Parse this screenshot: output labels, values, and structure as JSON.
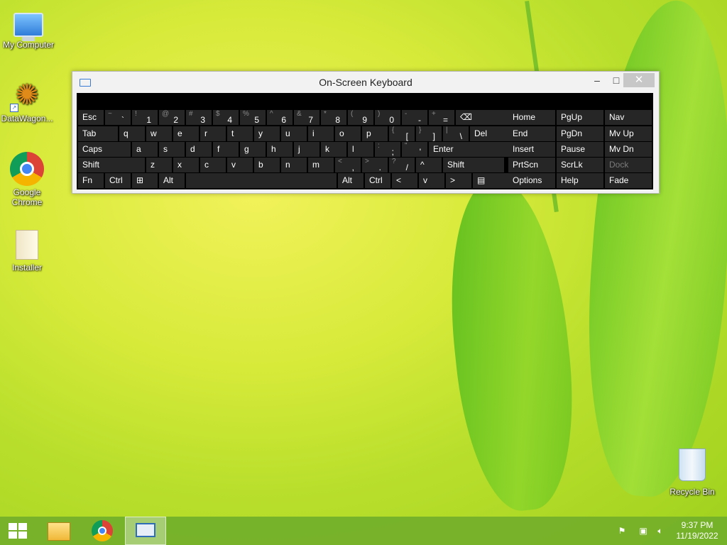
{
  "desktop": {
    "icons": [
      {
        "label": "My Computer",
        "icon": "computer-icon"
      },
      {
        "label": "DataWagon...",
        "icon": "datawagon-icon"
      },
      {
        "label": "Google Chrome",
        "icon": "chrome-icon"
      },
      {
        "label": "Installer",
        "icon": "folder-icon"
      },
      {
        "label": "Recycle Bin",
        "icon": "recycle-bin-icon"
      }
    ]
  },
  "osk": {
    "title": "On-Screen Keyboard",
    "controls": {
      "minimize": "–",
      "maximize": "□",
      "close": "✕"
    },
    "rows": [
      [
        {
          "id": "esc",
          "label": "Esc"
        },
        {
          "id": "tilde",
          "up": "~",
          "low": "`"
        },
        {
          "id": "1",
          "up": "!",
          "low": "1"
        },
        {
          "id": "2",
          "up": "@",
          "low": "2"
        },
        {
          "id": "3",
          "up": "#",
          "low": "3"
        },
        {
          "id": "4",
          "up": "$",
          "low": "4"
        },
        {
          "id": "5",
          "up": "%",
          "low": "5"
        },
        {
          "id": "6",
          "up": "^",
          "low": "6"
        },
        {
          "id": "7",
          "up": "&",
          "low": "7"
        },
        {
          "id": "8",
          "up": "*",
          "low": "8"
        },
        {
          "id": "9",
          "up": "(",
          "low": "9"
        },
        {
          "id": "0",
          "up": ")",
          "low": "0"
        },
        {
          "id": "minus",
          "up": "-",
          "low": "-"
        },
        {
          "id": "equals",
          "up": "+",
          "low": "="
        },
        {
          "id": "backspace",
          "label": "⌫"
        }
      ],
      [
        {
          "id": "tab",
          "label": "Tab"
        },
        {
          "id": "q",
          "label": "q"
        },
        {
          "id": "w",
          "label": "w"
        },
        {
          "id": "e",
          "label": "e"
        },
        {
          "id": "r",
          "label": "r"
        },
        {
          "id": "t",
          "label": "t"
        },
        {
          "id": "y",
          "label": "y"
        },
        {
          "id": "u",
          "label": "u"
        },
        {
          "id": "i",
          "label": "i"
        },
        {
          "id": "o",
          "label": "o"
        },
        {
          "id": "p",
          "label": "p"
        },
        {
          "id": "lbracket",
          "up": "{",
          "low": "["
        },
        {
          "id": "rbracket",
          "up": "}",
          "low": "]"
        },
        {
          "id": "backslash",
          "up": "|",
          "low": "\\"
        },
        {
          "id": "del",
          "label": "Del"
        }
      ],
      [
        {
          "id": "caps",
          "label": "Caps"
        },
        {
          "id": "a",
          "label": "a"
        },
        {
          "id": "s",
          "label": "s"
        },
        {
          "id": "d",
          "label": "d"
        },
        {
          "id": "f",
          "label": "f"
        },
        {
          "id": "g",
          "label": "g"
        },
        {
          "id": "h",
          "label": "h"
        },
        {
          "id": "j",
          "label": "j"
        },
        {
          "id": "k",
          "label": "k"
        },
        {
          "id": "l",
          "label": "l"
        },
        {
          "id": "semicolon",
          "up": ":",
          "low": ";"
        },
        {
          "id": "quote",
          "up": "\"",
          "low": "'"
        },
        {
          "id": "enter",
          "label": "Enter"
        }
      ],
      [
        {
          "id": "lshift",
          "label": "Shift"
        },
        {
          "id": "z",
          "label": "z"
        },
        {
          "id": "x",
          "label": "x"
        },
        {
          "id": "c",
          "label": "c"
        },
        {
          "id": "v",
          "label": "v"
        },
        {
          "id": "b",
          "label": "b"
        },
        {
          "id": "n",
          "label": "n"
        },
        {
          "id": "m",
          "label": "m"
        },
        {
          "id": "comma",
          "up": "<",
          "low": ","
        },
        {
          "id": "period",
          "up": ">",
          "low": "."
        },
        {
          "id": "slash",
          "up": "?",
          "low": "/"
        },
        {
          "id": "uparrow",
          "label": "^"
        },
        {
          "id": "rshift",
          "label": "Shift"
        }
      ],
      [
        {
          "id": "fn",
          "label": "Fn"
        },
        {
          "id": "lctrl",
          "label": "Ctrl"
        },
        {
          "id": "win",
          "label": "⊞"
        },
        {
          "id": "lalt",
          "label": "Alt"
        },
        {
          "id": "space",
          "label": ""
        },
        {
          "id": "ralt",
          "label": "Alt"
        },
        {
          "id": "rctrl",
          "label": "Ctrl"
        },
        {
          "id": "left",
          "label": "<"
        },
        {
          "id": "down",
          "label": "v"
        },
        {
          "id": "right",
          "label": ">"
        },
        {
          "id": "menu",
          "label": "▤"
        }
      ]
    ],
    "nav_keys": [
      [
        {
          "id": "home",
          "label": "Home"
        },
        {
          "id": "pgup",
          "label": "PgUp"
        },
        {
          "id": "nav",
          "label": "Nav"
        }
      ],
      [
        {
          "id": "end",
          "label": "End"
        },
        {
          "id": "pgdn",
          "label": "PgDn"
        },
        {
          "id": "mvup",
          "label": "Mv Up"
        }
      ],
      [
        {
          "id": "insert",
          "label": "Insert"
        },
        {
          "id": "pause",
          "label": "Pause"
        },
        {
          "id": "mvdn",
          "label": "Mv Dn"
        }
      ],
      [
        {
          "id": "prtscn",
          "label": "PrtScn"
        },
        {
          "id": "scrlk",
          "label": "ScrLk"
        },
        {
          "id": "dock",
          "label": "Dock",
          "disabled": true
        }
      ],
      [
        {
          "id": "options",
          "label": "Options"
        },
        {
          "id": "help",
          "label": "Help"
        },
        {
          "id": "fade",
          "label": "Fade"
        }
      ]
    ]
  },
  "taskbar": {
    "items": [
      "start-icon",
      "file-explorer-icon",
      "chrome-icon",
      "on-screen-keyboard-icon"
    ],
    "tray": {
      "time": "9:37 PM",
      "date": "11/19/2022"
    }
  },
  "colors": {
    "key_bg": "#262626",
    "osk_bg": "#000000",
    "taskbar": "#74b02a"
  }
}
